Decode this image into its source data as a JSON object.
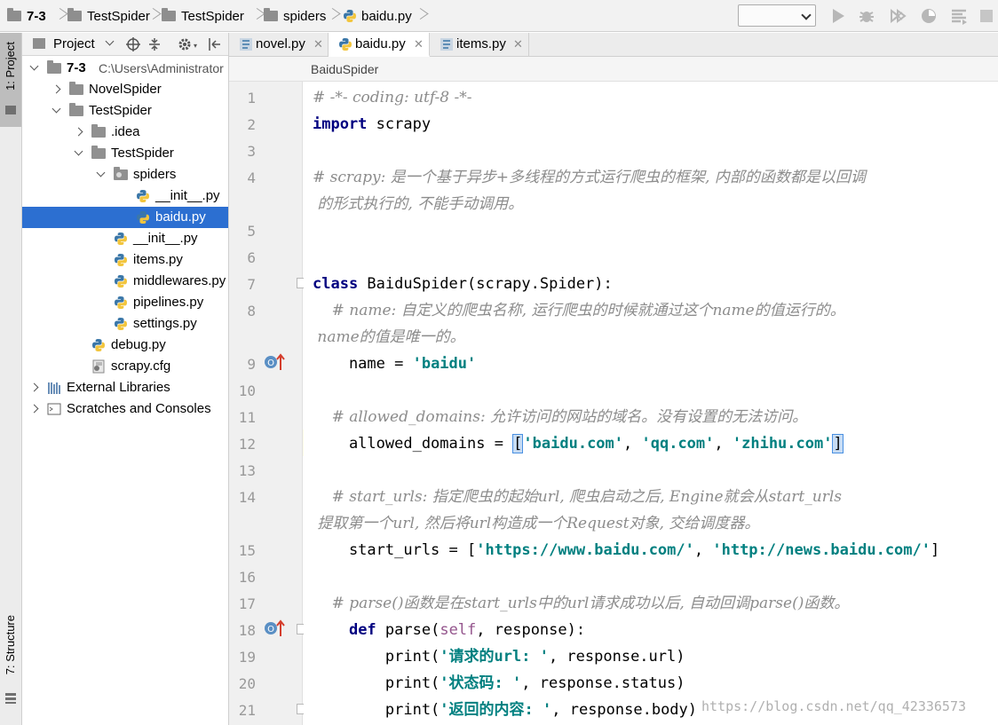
{
  "navbar": {
    "crumbs": [
      "7-3",
      "TestSpider",
      "TestSpider",
      "spiders",
      "baidu.py"
    ]
  },
  "sidebar": {
    "project_tab": "1: Project",
    "structure_tab": "7: Structure"
  },
  "project_panel": {
    "title": "Project",
    "tree": [
      {
        "label": "7-3",
        "hint": "C:\\Users\\Administrator",
        "type": "folder",
        "depth": 0,
        "expanded": true
      },
      {
        "label": "NovelSpider",
        "type": "folder",
        "depth": 1,
        "expanded": false
      },
      {
        "label": "TestSpider",
        "type": "folder",
        "depth": 1,
        "expanded": true
      },
      {
        "label": ".idea",
        "type": "folder",
        "depth": 2,
        "expanded": false
      },
      {
        "label": "TestSpider",
        "type": "folder",
        "depth": 2,
        "expanded": true
      },
      {
        "label": "spiders",
        "type": "package",
        "depth": 3,
        "expanded": true
      },
      {
        "label": "__init__.py",
        "type": "py",
        "depth": 4
      },
      {
        "label": "baidu.py",
        "type": "py",
        "depth": 4,
        "selected": true
      },
      {
        "label": "__init__.py",
        "type": "py",
        "depth": 3
      },
      {
        "label": "items.py",
        "type": "py",
        "depth": 3
      },
      {
        "label": "middlewares.py",
        "type": "py",
        "depth": 3
      },
      {
        "label": "pipelines.py",
        "type": "py",
        "depth": 3
      },
      {
        "label": "settings.py",
        "type": "py",
        "depth": 3
      },
      {
        "label": "debug.py",
        "type": "py",
        "depth": 2
      },
      {
        "label": "scrapy.cfg",
        "type": "cfg",
        "depth": 2
      },
      {
        "label": "External Libraries",
        "type": "lib",
        "depth": 0,
        "expanded": false
      },
      {
        "label": "Scratches and Consoles",
        "type": "scratch",
        "depth": 0,
        "expanded": false
      }
    ]
  },
  "editor": {
    "tabs": [
      {
        "label": "novel.py",
        "active": false
      },
      {
        "label": "baidu.py",
        "active": true
      },
      {
        "label": "items.py",
        "active": false
      }
    ],
    "breadcrumb": "BaiduSpider",
    "line_numbers": [
      "1",
      "2",
      "3",
      "4",
      "5",
      "6",
      "7",
      "8",
      "9",
      "10",
      "11",
      "12",
      "13",
      "14",
      "15",
      "16",
      "17",
      "18",
      "19",
      "20",
      "21"
    ],
    "code": {
      "l1": "# -*- coding: utf-8 -*-",
      "l2_kw": "import",
      "l2_rest": " scrapy",
      "l4a": "# scrapy: 是一个基于异步+多线程的方式运行爬虫的框架, 内部的函数都是以回调",
      "l4b": " 的形式执行的, 不能手动调用。",
      "l7_kw": "class",
      "l7_rest": " BaiduSpider(scrapy.Spider):",
      "l8a": "    # name: 自定义的爬虫名称, 运行爬虫的时候就通过这个name的值运行的。",
      "l8b": " name的值是唯一的。",
      "l9_a": "    name = ",
      "l9_s": "'baidu'",
      "l11": "    # allowed_domains: 允许访问的网站的域名。没有设置的无法访问。",
      "l12_a": "    allowed_domains = ",
      "l12_s1": "'baidu.com'",
      "l12_s2": "'qq.com'",
      "l12_s3": "'zhihu.com'",
      "l14a": "    # start_urls: 指定爬虫的起始url, 爬虫启动之后, Engine就会从start_urls",
      "l14b": " 提取第一个url, 然后将url构造成一个Request对象, 交给调度器。",
      "l15_a": "    start_urls = [",
      "l15_s1": "'https://www.baidu.com/'",
      "l15_s2": "'http://news.baidu.com/'",
      "l17": "    # parse()函数是在start_urls中的url请求成功以后, 自动回调parse()函数。",
      "l18_kw": "def",
      "l18_name": " parse(",
      "l18_self": "self",
      "l18_rest": ", response):",
      "l19_a": "        print(",
      "l19_s": "'请求的url: '",
      "l19_b": ", response.url)",
      "l20_a": "        print(",
      "l20_s": "'状态码: '",
      "l20_b": ", response.status)",
      "l21_a": "        print(",
      "l21_s": "'返回的内容: '",
      "l21_b": ", response.body)"
    },
    "watermark": "https://blog.csdn.net/qq_42336573"
  },
  "colors": {
    "selection": "#2c6fd1",
    "keyword": "#000080",
    "string": "#008080",
    "comment": "#8c8c8c"
  }
}
